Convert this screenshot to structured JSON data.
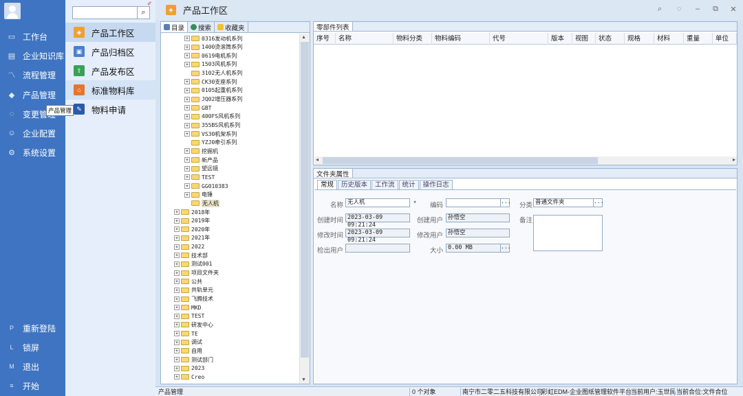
{
  "nav": {
    "items": [
      {
        "icon": "monitor-icon",
        "glyph": "▭",
        "label": "工作台"
      },
      {
        "icon": "book-icon",
        "glyph": "▤",
        "label": "企业知识库"
      },
      {
        "icon": "flow-icon",
        "glyph": "〽",
        "label": "流程管理"
      },
      {
        "icon": "cube-icon",
        "glyph": "◆",
        "label": "产品管理"
      },
      {
        "icon": "change-icon",
        "glyph": "◌",
        "label": "变更管理"
      },
      {
        "icon": "users-icon",
        "glyph": "☺",
        "label": "企业配置"
      },
      {
        "icon": "gear-icon",
        "glyph": "⚙",
        "label": "系统设置"
      }
    ],
    "bottom": [
      {
        "key": "P",
        "label": "重新登陆"
      },
      {
        "key": "L",
        "label": "锁屏"
      },
      {
        "key": "M",
        "label": "退出"
      },
      {
        "key": "≡",
        "label": "开始"
      }
    ],
    "tooltip": "产品管理"
  },
  "sub": {
    "items": [
      {
        "label": "产品工作区",
        "color": "#f0a030",
        "glyph": "◈"
      },
      {
        "label": "产品归档区",
        "color": "#4a7fd0",
        "glyph": "▣"
      },
      {
        "label": "产品发布区",
        "color": "#3aa055",
        "glyph": "⇪"
      },
      {
        "label": "标准物料库",
        "color": "#e8742c",
        "glyph": "⌂"
      },
      {
        "label": "物料申请",
        "color": "#2c5aa8",
        "glyph": "✎"
      }
    ]
  },
  "window": {
    "title": "产品工作区"
  },
  "left_tabs": [
    "目录",
    "搜索",
    "收藏夹"
  ],
  "tree": [
    {
      "l": 1,
      "t": "0316发动机系列",
      "p": true
    },
    {
      "l": 1,
      "t": "1400烫滚筒系列",
      "p": true
    },
    {
      "l": 1,
      "t": "0619电机系列",
      "p": true
    },
    {
      "l": 1,
      "t": "1503风机系列",
      "p": true
    },
    {
      "l": 1,
      "t": "3102无人机系列",
      "p": false
    },
    {
      "l": 1,
      "t": "CK30支座系列",
      "p": true
    },
    {
      "l": 1,
      "t": "0105起重机系列",
      "p": true
    },
    {
      "l": 1,
      "t": "JQ02增压器系列",
      "p": true
    },
    {
      "l": 1,
      "t": "GBT",
      "p": true
    },
    {
      "l": 1,
      "t": "400FS风机系列",
      "p": true
    },
    {
      "l": 1,
      "t": "355BS风机系列",
      "p": true
    },
    {
      "l": 1,
      "t": "VS30机架系列",
      "p": true
    },
    {
      "l": 1,
      "t": "YZJ0牵引系列",
      "p": false
    },
    {
      "l": 1,
      "t": "挖掘机",
      "p": true
    },
    {
      "l": 1,
      "t": "新产品",
      "p": true
    },
    {
      "l": 1,
      "t": "望远镜",
      "p": true
    },
    {
      "l": 1,
      "t": "TEST",
      "p": true
    },
    {
      "l": 1,
      "t": "GG010383",
      "p": true
    },
    {
      "l": 1,
      "t": "电锤",
      "p": true
    },
    {
      "l": 1,
      "t": "无人机",
      "p": false,
      "sel": true
    },
    {
      "l": 0,
      "t": "2018年",
      "p": true
    },
    {
      "l": 0,
      "t": "2019年",
      "p": true
    },
    {
      "l": 0,
      "t": "2020年",
      "p": true
    },
    {
      "l": 0,
      "t": "2021年",
      "p": true
    },
    {
      "l": 0,
      "t": "2022",
      "p": true
    },
    {
      "l": 0,
      "t": "技术部",
      "p": true
    },
    {
      "l": 0,
      "t": "测试001",
      "p": true
    },
    {
      "l": 0,
      "t": "项目文件夹",
      "p": true
    },
    {
      "l": 0,
      "t": "公共",
      "p": true
    },
    {
      "l": 0,
      "t": "共轨单元",
      "p": true
    },
    {
      "l": 0,
      "t": "飞腾技术",
      "p": true
    },
    {
      "l": 0,
      "t": "MKD",
      "p": true
    },
    {
      "l": 0,
      "t": "TEST",
      "p": true
    },
    {
      "l": 0,
      "t": "研发中心",
      "p": true
    },
    {
      "l": 0,
      "t": "TE",
      "p": true
    },
    {
      "l": 0,
      "t": "调试",
      "p": true
    },
    {
      "l": 0,
      "t": "自用",
      "p": true
    },
    {
      "l": 0,
      "t": "测试部门",
      "p": true
    },
    {
      "l": 0,
      "t": "2023",
      "p": true
    },
    {
      "l": 0,
      "t": "Creo",
      "p": true
    }
  ],
  "parts": {
    "tab": "零部件列表",
    "columns": [
      "序号",
      "名称",
      "物料分类",
      "物料编码",
      "代号",
      "版本",
      "视图",
      "状态",
      "规格",
      "材料",
      "重量",
      "单位"
    ]
  },
  "props": {
    "tab": "文件夹属性",
    "subtabs": [
      "常规",
      "历史版本",
      "工作流",
      "统计",
      "操作日志"
    ],
    "name_label": "名称",
    "name_value": "无人机",
    "required_mark": "*",
    "code_label": "编码",
    "code_value": "",
    "class_label": "分类",
    "class_value": "普通文件夹",
    "ctime_label": "创建时间",
    "ctime_value": "2023-03-09 09:21:24",
    "cuser_label": "创建用户",
    "cuser_value": "孙悟空",
    "note_label": "备注",
    "mtime_label": "修改时间",
    "mtime_value": "2023-03-09 09:21:24",
    "muser_label": "修改用户",
    "muser_value": "孙悟空",
    "checkout_label": "检出用户",
    "checkout_value": "",
    "size_label": "大小",
    "size_value": "0.00 MB",
    "dots": "..."
  },
  "status": {
    "left": "产品管理",
    "count": "0 个对象",
    "company": "南宁市二零二五科技有限公司",
    "product": "彩虹EDM-企业图纸管理软件平台",
    "user": "当前用户:玉世民",
    "unit": "当前合位:文件合位"
  }
}
